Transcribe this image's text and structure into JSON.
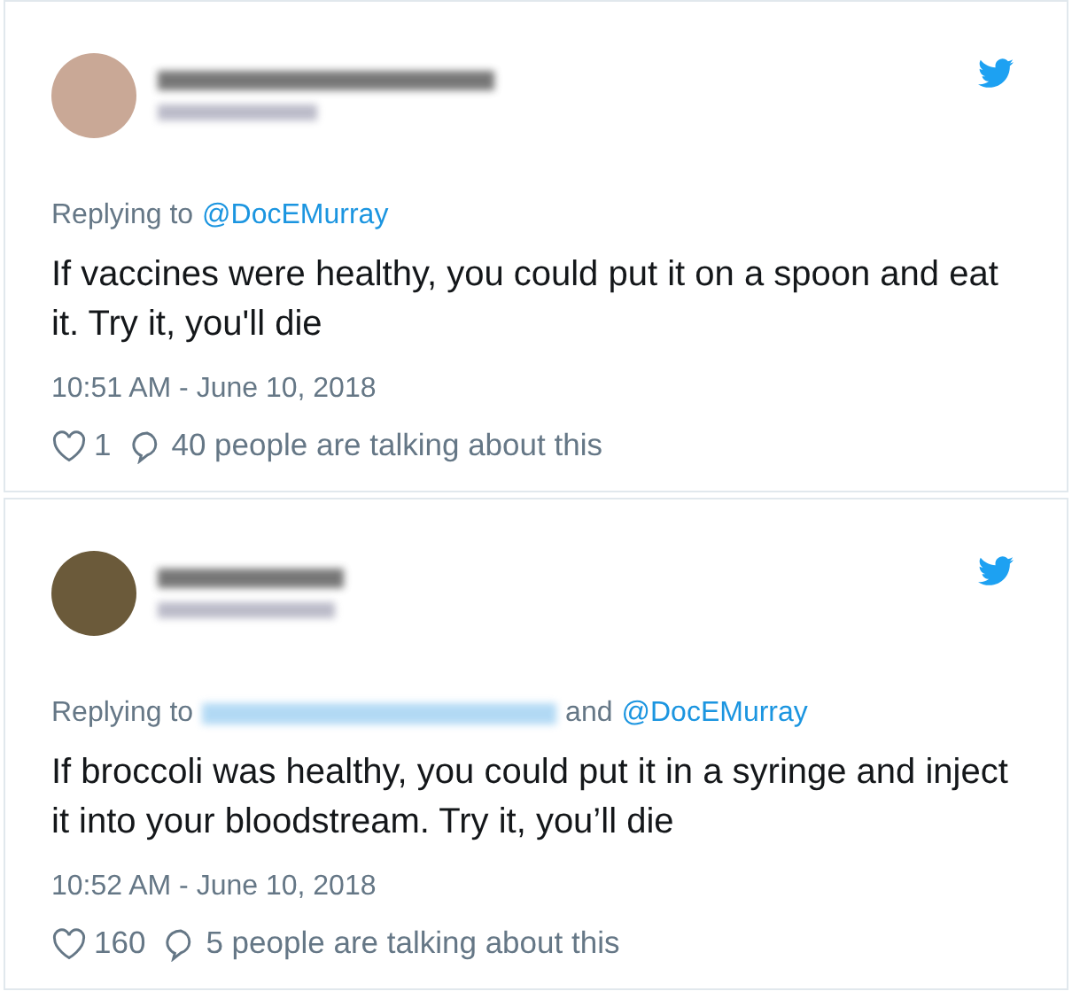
{
  "tweets": [
    {
      "author_redacted": true,
      "reply_prefix": "Replying to",
      "reply_to": [
        {
          "kind": "mention",
          "text": "@DocEMurray"
        }
      ],
      "text": "If vaccines were healthy, you could put it on a spoon and eat it. Try it, you'll die",
      "timestamp": "10:51 AM - June 10, 2018",
      "likes": "1",
      "talking": "40 people are talking about this"
    },
    {
      "author_redacted": true,
      "reply_prefix": "Replying to",
      "reply_to": [
        {
          "kind": "redacted"
        },
        {
          "kind": "word",
          "text": "and"
        },
        {
          "kind": "mention",
          "text": "@DocEMurray"
        }
      ],
      "text": "If broccoli was healthy, you could put it in a syringe and inject it into your bloodstream. Try it, you’ll die",
      "timestamp": "10:52 AM - June 10, 2018",
      "likes": "160",
      "talking": "5 people are talking about this"
    }
  ]
}
